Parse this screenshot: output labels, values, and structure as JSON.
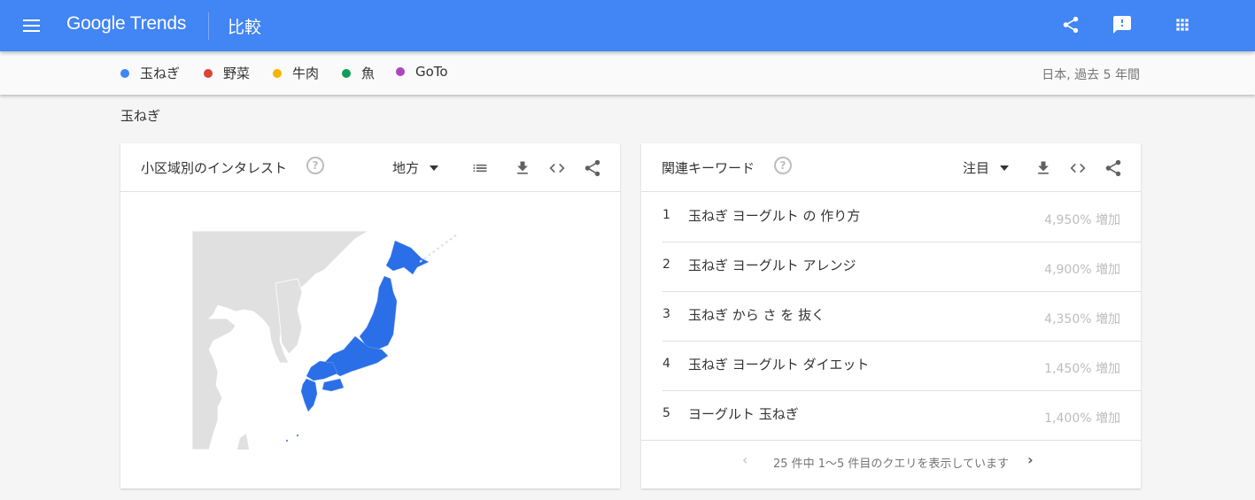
{
  "appbar": {
    "menu_icon": "menu-icon",
    "logo": "Google Trends",
    "page_title": "比較",
    "icons": [
      "share-icon",
      "feedback-icon",
      "apps-icon"
    ]
  },
  "terms": [
    {
      "label": "玉ねぎ",
      "color": "#4285f4"
    },
    {
      "label": "野菜",
      "color": "#db4437"
    },
    {
      "label": "牛肉",
      "color": "#f4b400"
    },
    {
      "label": "魚",
      "color": "#0f9d58"
    },
    {
      "label": "GoTo",
      "color": "#ab47bc"
    }
  ],
  "region_info": "日本, 過去 5 年間",
  "section_label": "玉ねぎ",
  "map_card": {
    "title": "小区域別のインタレスト",
    "help_icon": "?",
    "dropdown": "地方",
    "icons": [
      "list-icon",
      "download-icon",
      "embed-icon",
      "share-icon"
    ],
    "highlight_color": "#2a6ee8"
  },
  "keywords_card": {
    "title": "関連キーワード",
    "help_icon": "?",
    "dropdown": "注目",
    "icons": [
      "download-icon",
      "embed-icon",
      "share-icon"
    ],
    "rows": [
      {
        "rank": "1",
        "query": "玉ねぎ ヨーグルト の 作り方",
        "value": "4,950% 増加"
      },
      {
        "rank": "2",
        "query": "玉ねぎ ヨーグルト アレンジ",
        "value": "4,900% 増加"
      },
      {
        "rank": "3",
        "query": "玉ねぎ から さ を 抜く",
        "value": "4,350% 増加"
      },
      {
        "rank": "4",
        "query": "玉ねぎ ヨーグルト ダイエット",
        "value": "1,450% 増加"
      },
      {
        "rank": "5",
        "query": "ヨーグルト 玉ねぎ",
        "value": "1,400% 増加"
      }
    ],
    "pager_text": "25 件中 1～5 件目のクエリを表示しています",
    "pager_prev": "‹",
    "pager_next": "›"
  }
}
